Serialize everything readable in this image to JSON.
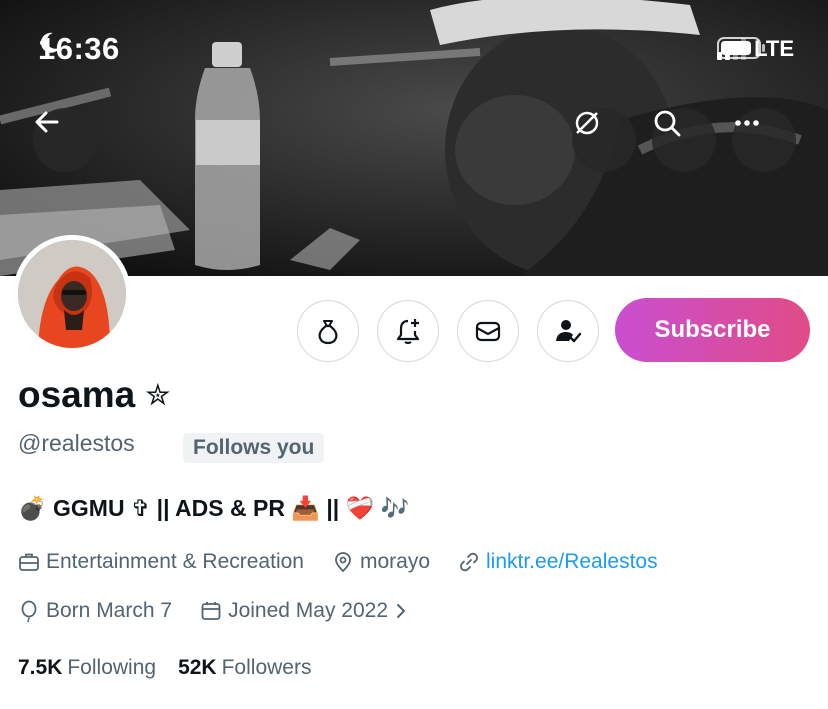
{
  "status_bar": {
    "time": "16:36",
    "network": "LTE"
  },
  "banner": {
    "description_icon": "photo-banner"
  },
  "profile": {
    "name": "osama",
    "name_badge": "✮",
    "handle": "@realestos",
    "follows_you": "Follows you",
    "bio": "💣 GGMU ✞ || ADS & PR 📥 || ❤️‍🩹 🎶",
    "category": "Entertainment & Recreation",
    "location": "morayo",
    "link": "linktr.ee/Realestos",
    "born": "Born March 7",
    "joined": "Joined May 2022",
    "following_count": "7.5K",
    "following_label": "Following",
    "followers_count": "52K",
    "followers_label": "Followers"
  },
  "actions": {
    "subscribe": "Subscribe"
  },
  "colors": {
    "link": "#1d9bf0",
    "secondary_text": "#536471",
    "subscribe_gradient_start": "#c94fd1",
    "subscribe_gradient_end": "#e14b87"
  }
}
